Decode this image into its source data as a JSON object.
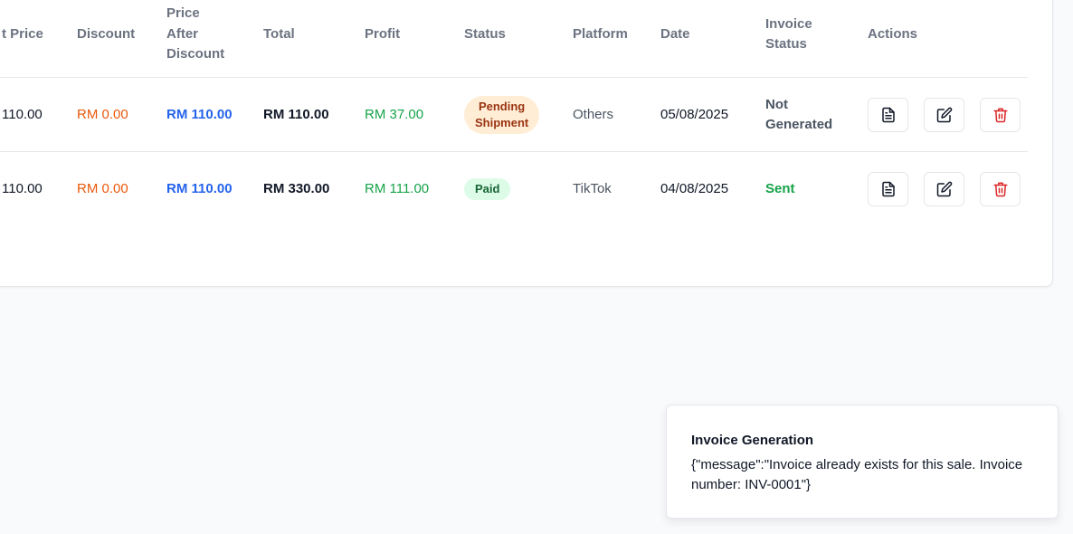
{
  "table": {
    "headers": {
      "unit_price": "t Price",
      "discount": "Discount",
      "price_after_discount_1": "Price",
      "price_after_discount_2": "After",
      "price_after_discount_3": "Discount",
      "total": "Total",
      "profit": "Profit",
      "status": "Status",
      "platform": "Platform",
      "date": "Date",
      "invoice_status_1": "Invoice",
      "invoice_status_2": "Status",
      "actions": "Actions"
    },
    "rows": [
      {
        "unit_price": "110.00",
        "discount": "RM 0.00",
        "price_after_discount": "RM 110.00",
        "total": "RM 110.00",
        "profit": "RM 37.00",
        "status_line1": "Pending",
        "status_line2": "Shipment",
        "platform": "Others",
        "date": "05/08/2025",
        "invoice_line1": "Not",
        "invoice_line2": "Generated"
      },
      {
        "unit_price": "110.00",
        "discount": "RM 0.00",
        "price_after_discount": "RM 110.00",
        "total": "RM 330.00",
        "profit": "RM 111.00",
        "status": "Paid",
        "platform": "TikTok",
        "date": "04/08/2025",
        "invoice": "Sent"
      }
    ]
  },
  "toast": {
    "title": "Invoice Generation",
    "message": "{\"message\":\"Invoice already exists for this sale. Invoice number: INV-0001\"}"
  },
  "icons": {
    "invoice": "document-icon",
    "edit": "edit-icon",
    "delete": "trash-icon"
  },
  "colors": {
    "discount": "#ea580c",
    "price_after_discount": "#2563eb",
    "profit": "#16a34a",
    "pending_badge_bg": "#ffedd5",
    "pending_badge_text": "#9a3412",
    "paid_badge_bg": "#dcfce7",
    "paid_badge_text": "#166534",
    "delete_icon": "#dc2626"
  }
}
